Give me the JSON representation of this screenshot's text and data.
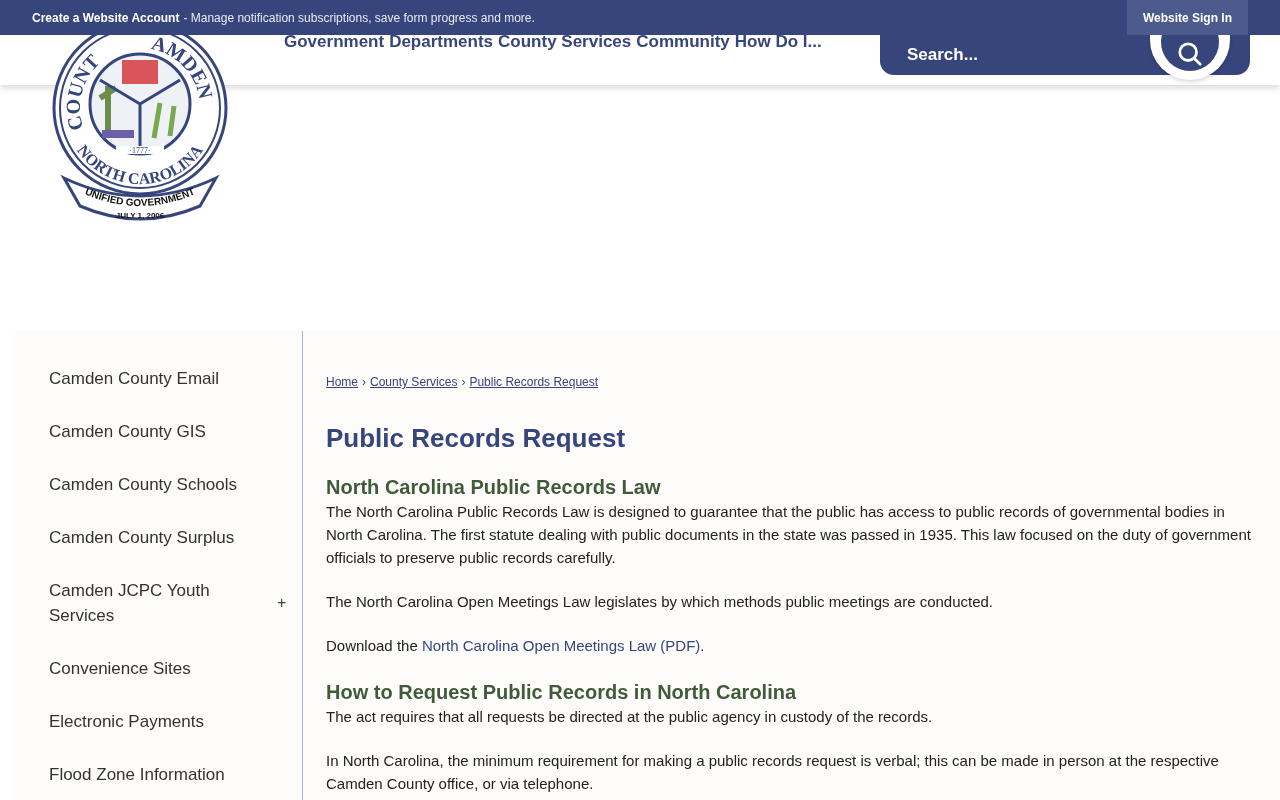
{
  "top_bar": {
    "account_link": "Create a Website Account",
    "message": "- Manage notification subscriptions, save form progress and more.",
    "sign_in": "Website Sign In"
  },
  "logo": {
    "arc_left": "COUNT",
    "arc_right": "AMDEN",
    "year": "·1777·",
    "state": "NORTH CAROLINA",
    "banner": "UNIFIED GOVERNMENT",
    "date": "JULY 1, 2006"
  },
  "nav": [
    "Government",
    "Departments",
    "County Services",
    "Community",
    "How Do I..."
  ],
  "search": {
    "placeholder": "Search..."
  },
  "sidebar": {
    "items": [
      {
        "label": "Camden County Email"
      },
      {
        "label": "Camden County GIS"
      },
      {
        "label": "Camden County Schools"
      },
      {
        "label": "Camden County Surplus"
      },
      {
        "label": "Camden JCPC Youth Services",
        "toggle": "+"
      },
      {
        "label": "Convenience Sites"
      },
      {
        "label": "Electronic Payments"
      },
      {
        "label": "Flood Zone Information"
      }
    ]
  },
  "breadcrumb": {
    "separator": "›",
    "items": [
      "Home",
      "County Services",
      "Public Records Request"
    ]
  },
  "title": "Public Records Request",
  "sections": [
    {
      "heading": "North Carolina Public Records Law",
      "paragraphs": [
        {
          "kind": "text",
          "text": "The North Carolina Public Records Law is designed to guarantee that the public has access to public records of governmental bodies in North Carolina. The first statute dealing with public documents in the state was passed in 1935. This law focused on the duty of government officials to preserve public records carefully."
        },
        {
          "kind": "text",
          "text": "The North Carolina Open Meetings Law legislates by which methods public meetings are conducted."
        },
        {
          "kind": "link",
          "before": "Download the ",
          "link": "North Carolina Open Meetings Law (PDF)",
          "after": "."
        }
      ]
    },
    {
      "heading": "How to Request Public Records in North Carolina",
      "paragraphs": [
        {
          "kind": "text",
          "text": "The act requires that all requests be directed at the public agency in custody of the records."
        },
        {
          "kind": "text",
          "text": "In North Carolina, the minimum requirement for making a public records request is verbal; this can be made in person at the respective Camden County office, or via telephone."
        }
      ]
    }
  ]
}
